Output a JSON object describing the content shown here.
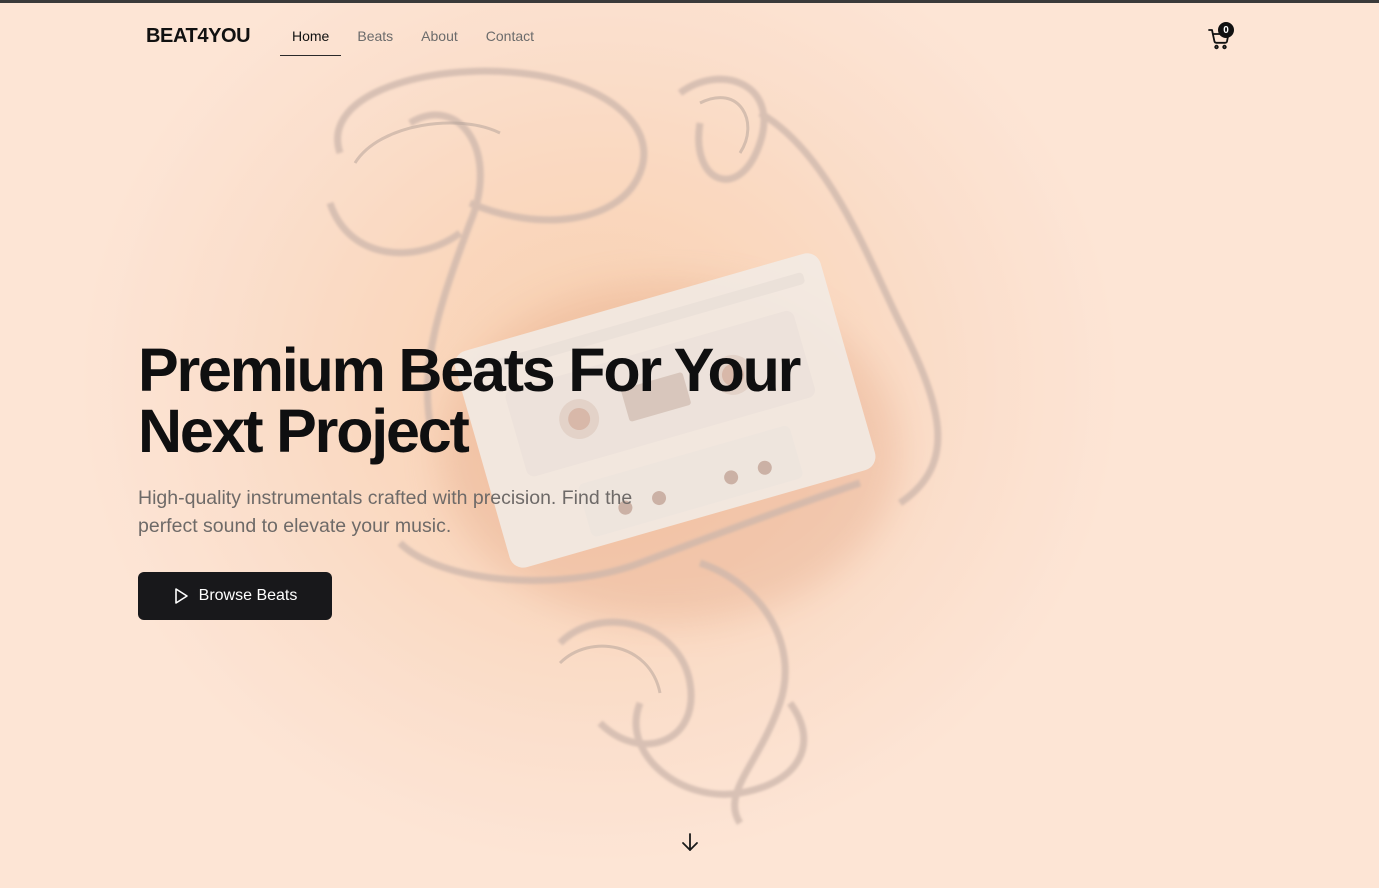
{
  "header": {
    "logo": "BEAT4YOU",
    "nav": [
      "Home",
      "Beats",
      "About",
      "Contact"
    ],
    "active_nav": "Home",
    "cart_count": "0",
    "cart_icon": "shopping-cart-icon"
  },
  "hero": {
    "title_line1": "Premium Beats For Your",
    "title_line2": "Next Project",
    "subtitle_line1": "High-quality instrumentals crafted with precision. Find the",
    "subtitle_line2": "perfect sound to elevate your music.",
    "cta_label": "Browse Beats",
    "cta_icon": "play-icon",
    "scroll_icon": "arrow-down-icon",
    "background_image": "cassette-tape-photo"
  },
  "colors": {
    "background": "#f9d9c4",
    "text_primary": "#0f0f10",
    "text_muted": "#6e6a68",
    "button_bg": "#18181b",
    "button_text": "#ffffff"
  }
}
